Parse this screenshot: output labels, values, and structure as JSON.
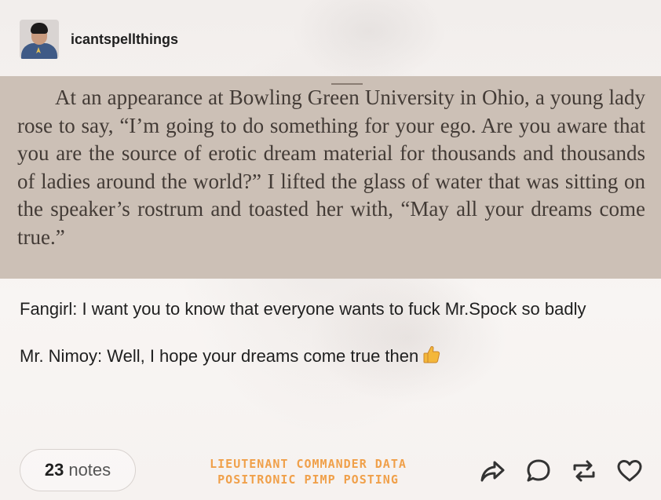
{
  "post": {
    "username": "icantspellthings",
    "book_excerpt": "At an appearance at Bowling Green University in Ohio, a young lady rose to say, “I’m going to do something for your ego. Are you aware that you are the source of erotic dream material for thousands and thousands of ladies around the world?” I lifted the glass of water that was sitting on the speaker’s rostrum and toasted her with, “May all your dreams come true.”",
    "paragraphs": [
      "Fangirl: I want you to know that everyone wants to fuck Mr.Spock so badly",
      "Mr. Nimoy: Well, I hope your dreams come true then"
    ],
    "emoji": "thumbs-up-icon"
  },
  "footer": {
    "notes_count": "23",
    "notes_label": "notes",
    "watermark_line1": "LIEUTENANT COMMANDER DATA",
    "watermark_line2": "POSITRONIC PIMP POSTING",
    "actions": [
      "share-icon",
      "reply-icon",
      "reblog-icon",
      "like-icon"
    ]
  },
  "colors": {
    "watermark": "#f0a04a",
    "book_bg": "#ccc0b6",
    "text": "#1f1f1f"
  }
}
